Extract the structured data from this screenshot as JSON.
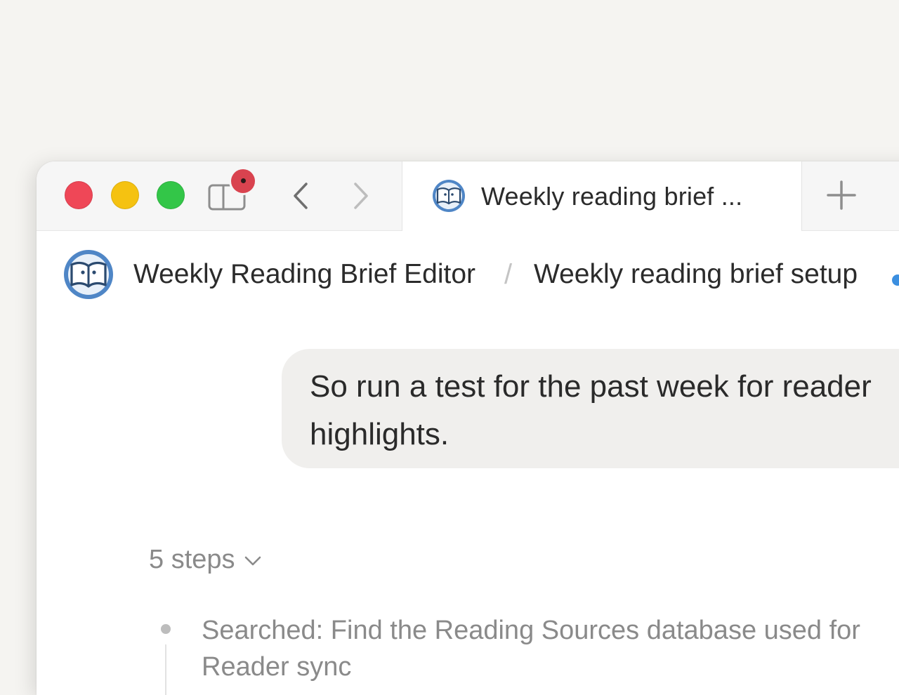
{
  "tab": {
    "title": "Weekly reading brief ..."
  },
  "breadcrumb": {
    "app_name": "Weekly Reading Brief Editor",
    "separator": "/",
    "page_name": "Weekly reading brief setup"
  },
  "chat": {
    "user_message": "So run a test for the past week for reader\nhighlights."
  },
  "steps": {
    "toggle_label": "5 steps",
    "items": [
      {
        "text": "Searched: Find the Reading Sources database used for\nReader sync"
      }
    ]
  },
  "colors": {
    "close": "#ef4757",
    "minimize": "#f5c211",
    "zoom": "#33c648",
    "notification": "#d9434f",
    "status": "#3b8fe0"
  },
  "icons": {
    "app": "open-book-icon",
    "sidebar": "sidebar-toggle-icon",
    "back": "chevron-left-icon",
    "forward": "chevron-right-icon",
    "new_tab": "plus-icon",
    "expand": "chevron-down-icon"
  }
}
